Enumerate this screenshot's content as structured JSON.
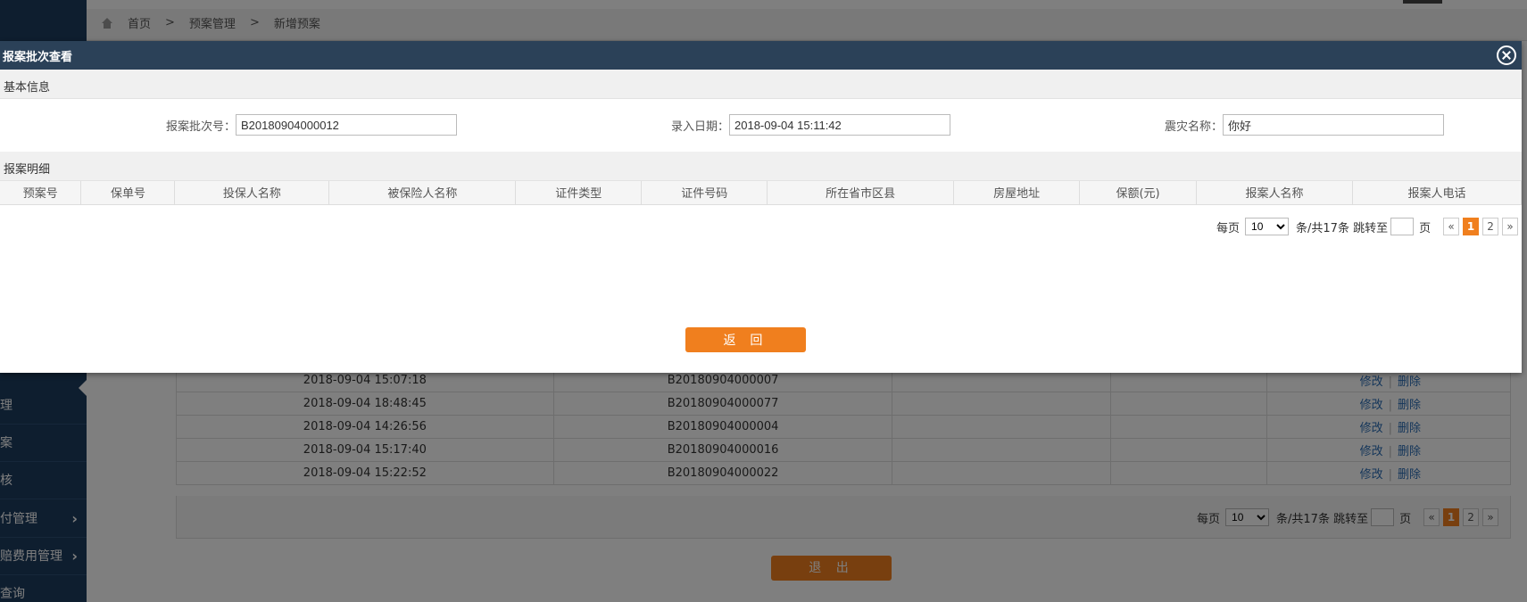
{
  "breadcrumb": {
    "items": [
      "首页",
      "预案管理",
      "新增预案"
    ],
    "separator": ">"
  },
  "sidebar": {
    "items": [
      {
        "label": "理",
        "has_arrow": false
      },
      {
        "label": "案",
        "has_arrow": false
      },
      {
        "label": "核",
        "has_arrow": false
      },
      {
        "label": "付管理",
        "has_arrow": true
      },
      {
        "label": "赔费用管理",
        "has_arrow": true
      },
      {
        "label": "查询",
        "has_arrow": false
      }
    ]
  },
  "background_table": {
    "rows": [
      {
        "date": "2018-09-04 15:07:18",
        "batch": "B20180904000007"
      },
      {
        "date": "2018-09-04 18:48:45",
        "batch": "B20180904000077"
      },
      {
        "date": "2018-09-04 14:26:56",
        "batch": "B20180904000004"
      },
      {
        "date": "2018-09-04 15:17:40",
        "batch": "B20180904000016"
      },
      {
        "date": "2018-09-04 15:22:52",
        "batch": "B20180904000022"
      }
    ],
    "edit_label": "修改",
    "delete_label": "删除",
    "op_separator": "|"
  },
  "background_pager": {
    "per_page_label": "每页",
    "page_size": "10",
    "total_label": "条/共17条 跳转至",
    "page_unit": "页",
    "pages": [
      "«",
      "1",
      "2",
      "»"
    ],
    "current": "1"
  },
  "background_exit_label": "退 出",
  "modal": {
    "title": "报案批次查看",
    "basic_section": "基本信息",
    "fields": {
      "batch_no": {
        "label": "报案批次号：",
        "value": "B20180904000012"
      },
      "entry_date": {
        "label": "录入日期：",
        "value": "2018-09-04 15:11:42"
      },
      "disaster_name": {
        "label": "震灾名称：",
        "value": "你好"
      }
    },
    "detail_section": "报案明细",
    "columns": [
      "预案号",
      "保单号",
      "投保人名称",
      "被保险人名称",
      "证件类型",
      "证件号码",
      "所在省市区县",
      "房屋地址",
      "保额(元)",
      "报案人名称",
      "报案人电话"
    ],
    "pager": {
      "per_page_label": "每页",
      "page_size": "10",
      "total_label": "条/共17条 跳转至",
      "page_unit": "页",
      "pages": [
        "«",
        "1",
        "2",
        "»"
      ],
      "current": "1"
    },
    "return_label": "返 回"
  },
  "colors": {
    "accent": "#f07f1e",
    "header": "#2b4158",
    "sidebar": "#1d3c5e",
    "link": "#2a6db5"
  }
}
